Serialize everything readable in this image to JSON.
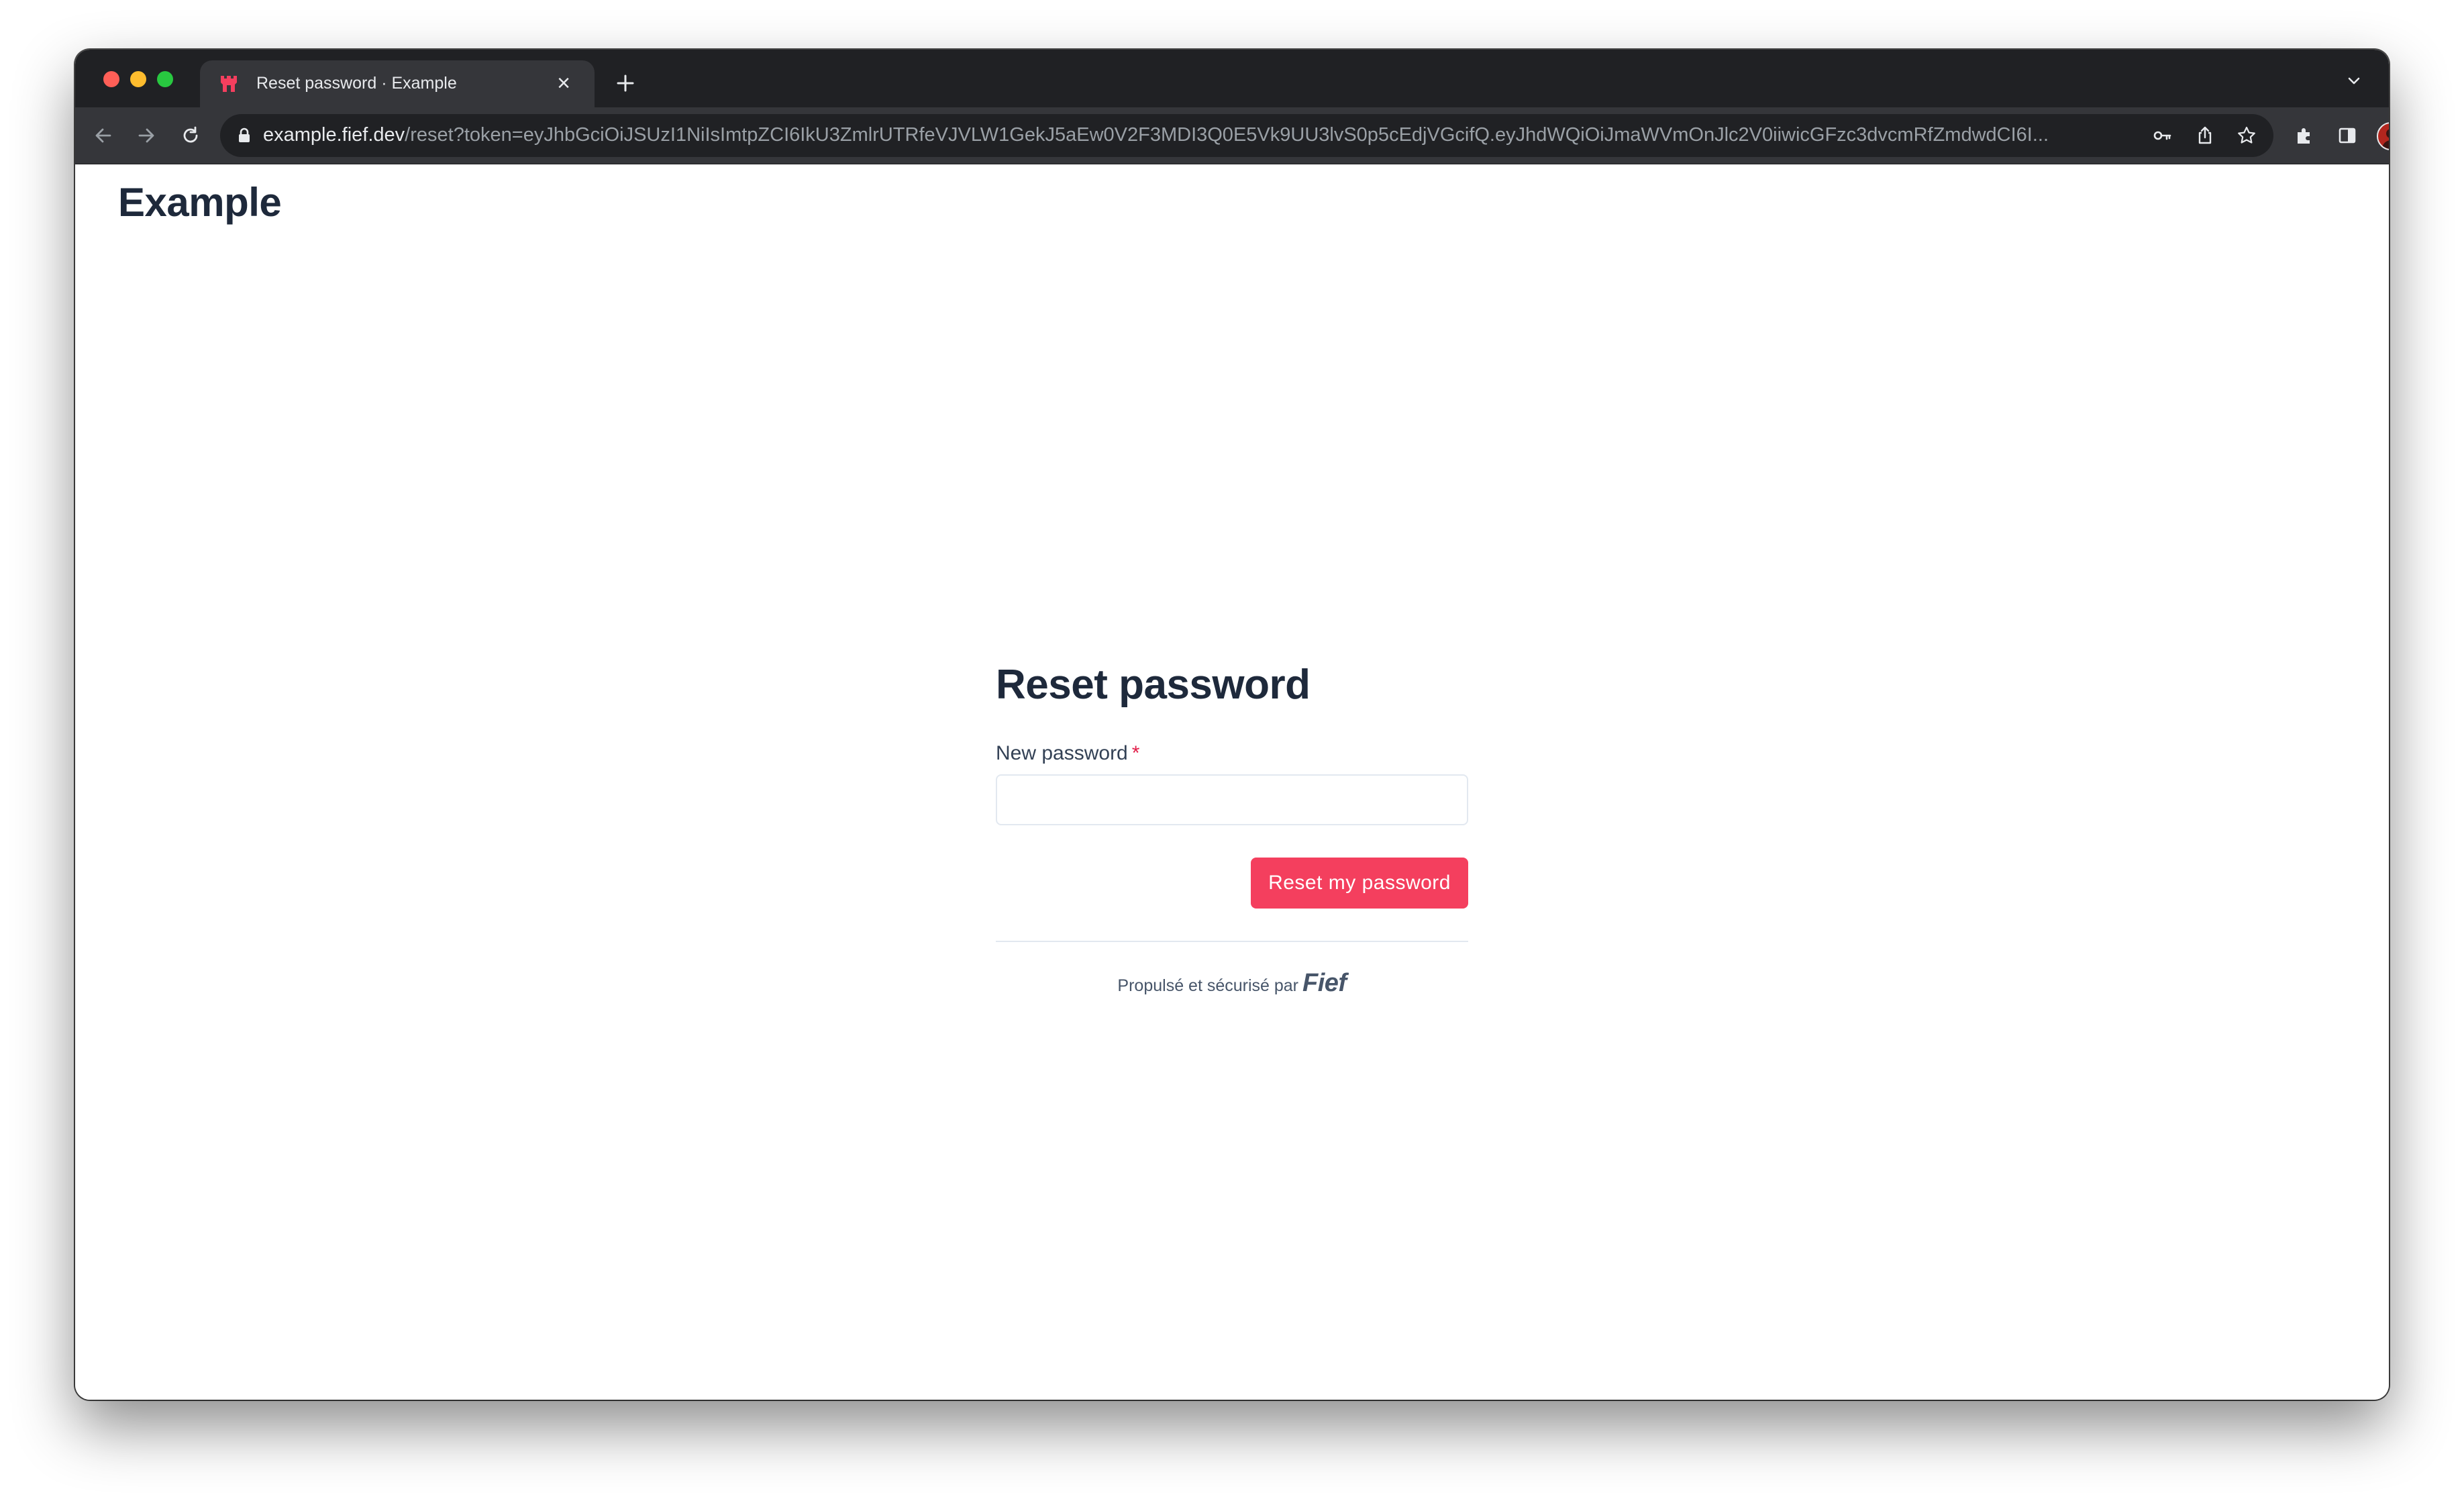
{
  "browser": {
    "tab": {
      "title": "Reset password · Example",
      "close_glyph": "×",
      "favicon": "fief-castle-icon"
    },
    "new_tab_icon": "plus-icon",
    "address_bar": {
      "host": "example.fief.dev",
      "path": "/reset?token=eyJhbGciOiJSUzI1NiIsImtpZCI6IkU3ZmlrUTRfeVJVLW1GekJ5aEw0V2F3MDI3Q0E5Vk9UU3lvS0p5cEdjVGcifQ.eyJhdWQiOiJmaWVmOnJlc2V0iiwicGFzc3dvcmRfZmdwdCI6I...",
      "icons": [
        "lock-icon",
        "key-icon",
        "share-icon",
        "star-icon"
      ]
    },
    "toolbar_icons": [
      "back-icon",
      "forward-icon",
      "reload-icon",
      "extensions-icon",
      "side-panel-icon",
      "avatar",
      "menu-icon"
    ]
  },
  "page": {
    "brand": "Example",
    "form": {
      "title": "Reset password",
      "password_label": "New password",
      "required_mark": "*",
      "password_value": "",
      "submit_label": "Reset my password"
    },
    "footer": {
      "powered_by": "Propulsé et sécurisé par",
      "logo_text": "Fief"
    }
  },
  "colors": {
    "accent": "#f43f5e",
    "heading": "#1e293b",
    "chrome_dark": "#202124",
    "chrome_toolbar": "#35363a"
  }
}
